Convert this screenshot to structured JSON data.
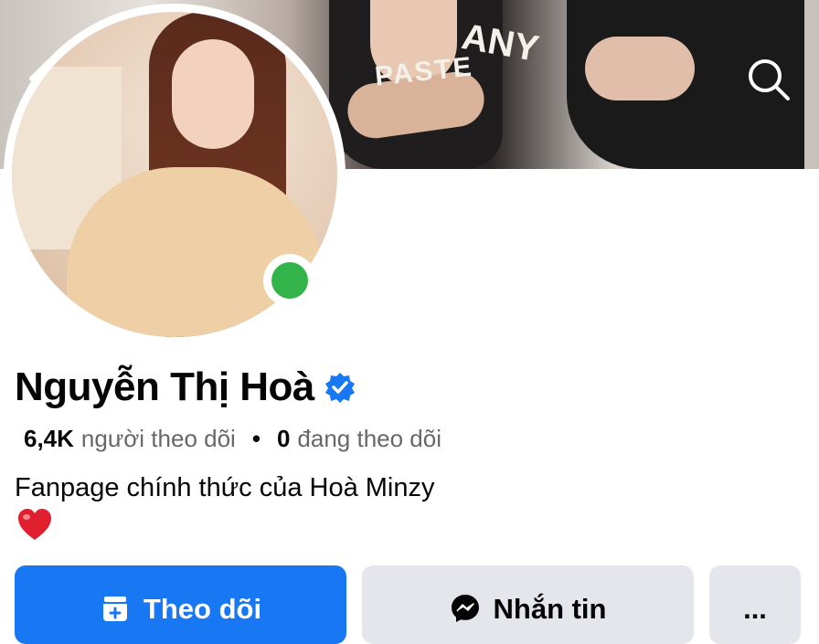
{
  "profile": {
    "name": "Nguyễn Thị Hoà",
    "verified": true,
    "online": true,
    "followers_count": "6,4K",
    "followers_label": "người theo dõi",
    "following_count": "0",
    "following_label": "đang theo dõi",
    "separator": "•",
    "bio": "Fanpage chính thức của Hoà Minzy",
    "bio_emoji": "heart-emoji"
  },
  "cover": {
    "shirt_text_1": "PASTE",
    "shirt_text_2": "ANY"
  },
  "actions": {
    "follow_label": "Theo dõi",
    "message_label": "Nhắn tin",
    "more_label": "..."
  },
  "icons": {
    "back": "chevron-left-icon",
    "search": "search-icon",
    "verified": "verified-badge-icon",
    "follow": "follow-page-icon",
    "messenger": "messenger-icon"
  },
  "colors": {
    "accent": "#1877f2",
    "online": "#32b44a",
    "secondary_button": "#e4e6eb",
    "muted_text": "#65676b"
  }
}
